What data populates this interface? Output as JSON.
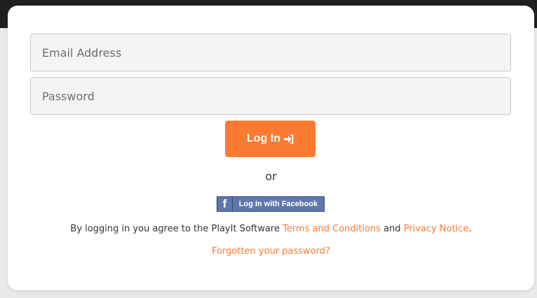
{
  "login_form": {
    "email": {
      "placeholder": "Email Address",
      "value": ""
    },
    "password": {
      "placeholder": "Password",
      "value": ""
    },
    "login_button_label": "Log In",
    "login_icon": "sign-in-icon",
    "or_text": "or",
    "facebook": {
      "icon": "facebook-f-icon",
      "icon_glyph": "f",
      "label": "Log In with Facebook",
      "color": "#5f78ab"
    },
    "terms": {
      "prefix": "By logging in you agree to the PlayIt Software ",
      "terms_link": "Terms and Conditions",
      "middle": " and ",
      "privacy_link": "Privacy Notice",
      "suffix": "."
    },
    "forgot_password": "Forgotten your password?"
  },
  "colors": {
    "accent": "#fa7a32",
    "topbar": "#1f1f1f"
  }
}
